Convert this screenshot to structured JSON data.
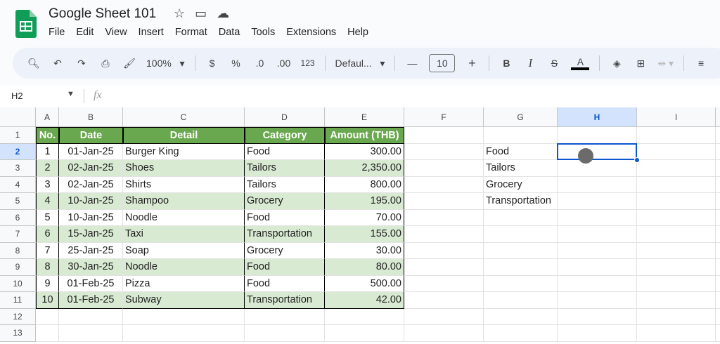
{
  "app": {
    "title": "Google Sheet 101",
    "menu": [
      "File",
      "Edit",
      "View",
      "Insert",
      "Format",
      "Data",
      "Tools",
      "Extensions",
      "Help"
    ]
  },
  "toolbar": {
    "zoom": "100%",
    "currency": "$",
    "percent": "%",
    "dec_decrease": ".0",
    "dec_increase": ".00",
    "number_format": "123",
    "font": "Defaul...",
    "font_size": "10"
  },
  "formula_bar": {
    "cell_ref": "H2",
    "fx": "fx",
    "value": ""
  },
  "columns": [
    "A",
    "B",
    "C",
    "D",
    "E",
    "F",
    "G",
    "H",
    "I"
  ],
  "rows": [
    "1",
    "2",
    "3",
    "4",
    "5",
    "6",
    "7",
    "8",
    "9",
    "10",
    "11",
    "12",
    "13"
  ],
  "table": {
    "headers": [
      "No.",
      "Date",
      "Detail",
      "Category",
      "Amount (THB)"
    ],
    "data": [
      [
        "1",
        "01-Jan-25",
        "Burger King",
        "Food",
        "300.00"
      ],
      [
        "2",
        "02-Jan-25",
        "Shoes",
        "Tailors",
        "2,350.00"
      ],
      [
        "3",
        "02-Jan-25",
        "Shirts",
        "Tailors",
        "800.00"
      ],
      [
        "4",
        "10-Jan-25",
        "Shampoo",
        "Grocery",
        "195.00"
      ],
      [
        "5",
        "10-Jan-25",
        "Noodle",
        "Food",
        "70.00"
      ],
      [
        "6",
        "15-Jan-25",
        "Taxi",
        "Transportation",
        "155.00"
      ],
      [
        "7",
        "25-Jan-25",
        "Soap",
        "Grocery",
        "30.00"
      ],
      [
        "8",
        "30-Jan-25",
        "Noodle",
        "Food",
        "80.00"
      ],
      [
        "9",
        "01-Feb-25",
        "Pizza",
        "Food",
        "500.00"
      ],
      [
        "10",
        "01-Feb-25",
        "Subway",
        "Transportation",
        "42.00"
      ]
    ]
  },
  "categories": [
    "Food",
    "Tailors",
    "Grocery",
    "Transportation"
  ],
  "colors": {
    "header_green": "#6aa84f",
    "row_green": "#d9ead3",
    "selection": "#0b57d0"
  }
}
